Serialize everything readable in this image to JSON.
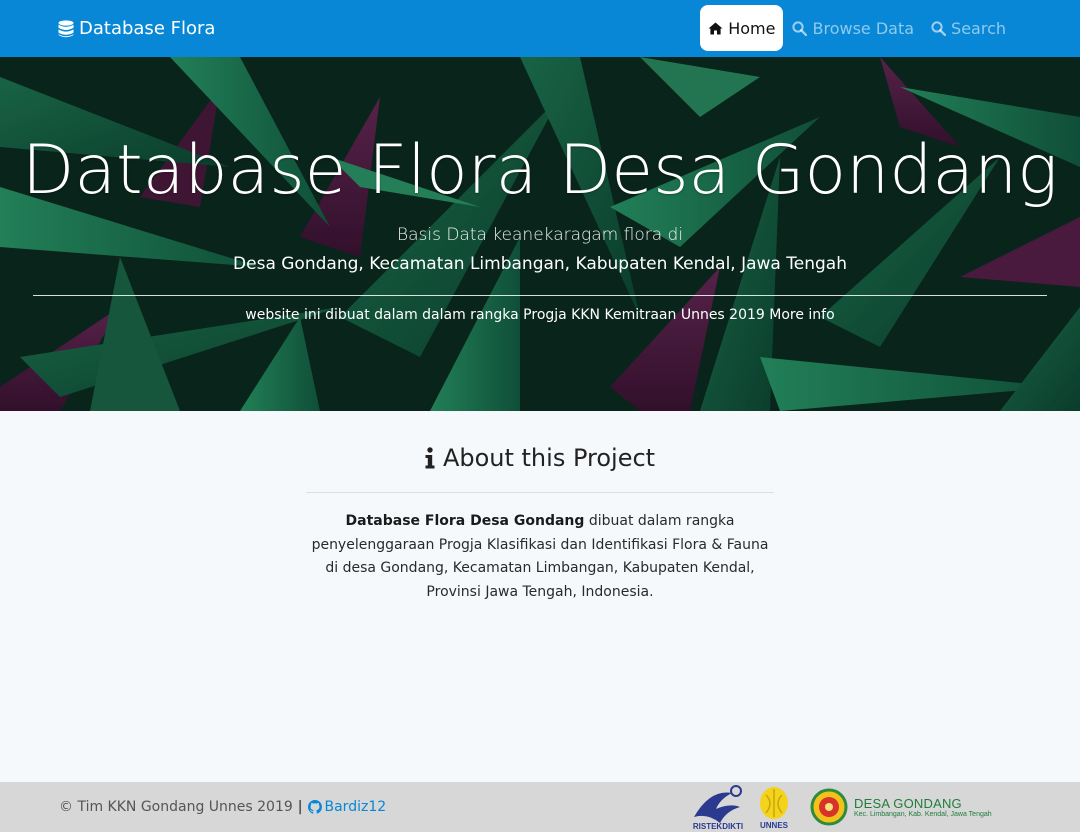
{
  "navbar": {
    "brand": "Database Flora",
    "brand_icon": "database-icon",
    "items": [
      {
        "label": "Home",
        "icon": "home-icon",
        "active": true
      },
      {
        "label": "Browse Data",
        "icon": "search-icon",
        "active": false
      },
      {
        "label": "Search",
        "icon": "search-icon",
        "active": false
      }
    ],
    "color": "#0787d6"
  },
  "hero": {
    "title": "Database Flora Desa Gondang",
    "subtitle_line1": "Basis Data keanekaragam flora di",
    "subtitle_line2": "Desa Gondang, Kecamatan Limbangan, Kabupaten Kendal, Jawa Tengah",
    "note_text": "website ini dibuat dalam dalam rangka Progja KKN Kemitraan Unnes 2019 ",
    "note_link": "More info"
  },
  "about": {
    "title": "About this Project",
    "title_icon": "info-icon",
    "body_strong": "Database Flora Desa Gondang",
    "body_rest": " dibuat dalam rangka penyelenggaraan Progja Klasifikasi dan Identifikasi Flora & Fauna di desa Gondang, Kecamatan Limbangan, Kabupaten Kendal, Provinsi Jawa Tengah, Indonesia."
  },
  "footer": {
    "copyright": "© Tim KKN Gondang Unnes 2019",
    "separator": "|",
    "github_label": "Bardiz12",
    "github_icon": "github-icon",
    "logos": [
      {
        "name": "ristekdikti-logo",
        "text": "RISTEKDIKTI"
      },
      {
        "name": "unnes-logo",
        "text": "UNNES"
      },
      {
        "name": "desa-gondang-logo",
        "title": "DESA GONDANG",
        "subtitle": "Kec. Limbangan, Kab. Kendal, Jawa Tengah"
      }
    ]
  }
}
